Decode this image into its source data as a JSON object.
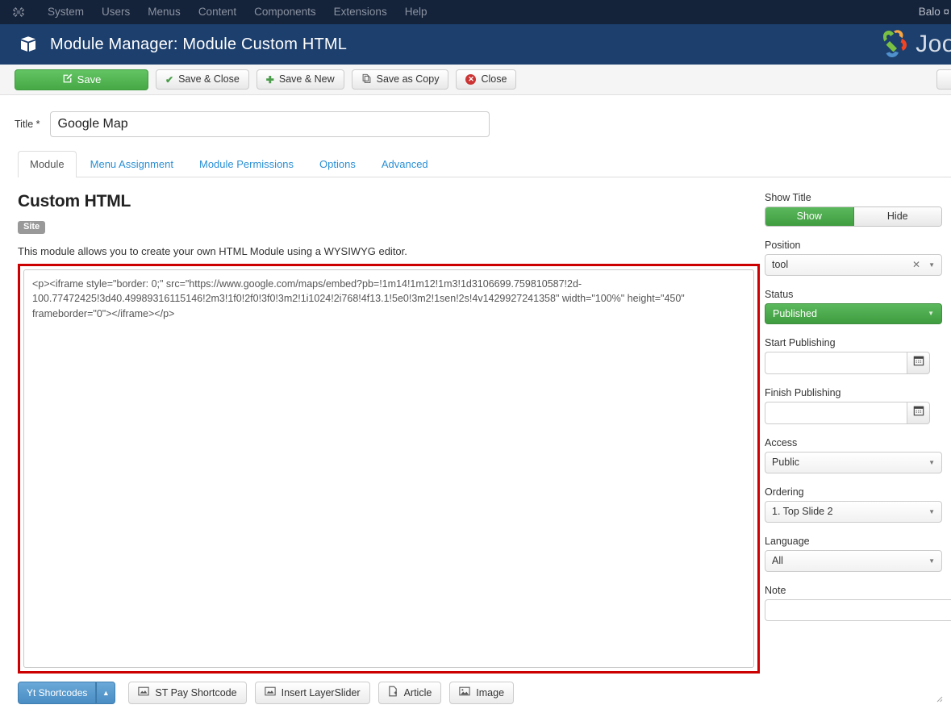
{
  "adminbar": {
    "logo_icon": "joomla-logo-icon",
    "menu": [
      "System",
      "Users",
      "Menus",
      "Content",
      "Components",
      "Extensions",
      "Help"
    ],
    "user": "Balo ¤"
  },
  "header": {
    "icon": "module-box-icon",
    "title": "Module Manager: Module Custom HTML",
    "brand_text": "Joo"
  },
  "toolbar": {
    "save_label": "Save",
    "save_close_label": "Save & Close",
    "save_new_label": "Save & New",
    "save_copy_label": "Save as Copy",
    "close_label": "Close"
  },
  "title_field": {
    "label": "Title *",
    "value": "Google Map"
  },
  "tabs": [
    {
      "label": "Module",
      "active": true
    },
    {
      "label": "Menu Assignment",
      "active": false
    },
    {
      "label": "Module Permissions",
      "active": false
    },
    {
      "label": "Options",
      "active": false
    },
    {
      "label": "Advanced",
      "active": false
    }
  ],
  "main": {
    "heading": "Custom HTML",
    "badge": "Site",
    "description": "This module allows you to create your own HTML Module using a WYSIWYG editor.",
    "editor_content": "<p><iframe style=\"border: 0;\" src=\"https://www.google.com/maps/embed?pb=!1m14!1m12!1m3!1d3106699.759810587!2d-100.77472425!3d40.49989316115146!2m3!1f0!2f0!3f0!3m2!1i1024!2i768!4f13.1!5e0!3m2!1sen!2s!4v1429927241358\" width=\"100%\" height=\"450\" frameborder=\"0\"></iframe></p>",
    "editor_buttons": [
      {
        "label": "Yt Shortcodes",
        "icon": "caret-up-icon"
      },
      {
        "label": "ST Pay Shortcode",
        "icon": "image-frame-icon"
      },
      {
        "label": "Insert LayerSlider",
        "icon": "image-frame-icon"
      },
      {
        "label": "Article",
        "icon": "article-page-icon"
      },
      {
        "label": "Image",
        "icon": "picture-icon"
      }
    ]
  },
  "sidebar": {
    "show_title": {
      "label": "Show Title",
      "options": [
        "Show",
        "Hide"
      ],
      "selected": "Show"
    },
    "position": {
      "label": "Position",
      "value": "tool",
      "clear_icon": "clear-x-icon",
      "caret_icon": "chevron-down-icon"
    },
    "status": {
      "label": "Status",
      "value": "Published"
    },
    "start_publishing": {
      "label": "Start Publishing",
      "value": "",
      "icon": "calendar-icon"
    },
    "finish_publishing": {
      "label": "Finish Publishing",
      "value": "",
      "icon": "calendar-icon"
    },
    "access": {
      "label": "Access",
      "value": "Public"
    },
    "ordering": {
      "label": "Ordering",
      "value": "1. Top Slide 2"
    },
    "language": {
      "label": "Language",
      "value": "All"
    },
    "note": {
      "label": "Note",
      "value": ""
    }
  },
  "colors": {
    "adminbar_bg": "#14223a",
    "header_bg": "#1c3f6e",
    "accent_green": "#45a845",
    "link_blue": "#2a8fd4",
    "highlight_red": "#cc0000",
    "badge_gray": "#999999"
  }
}
